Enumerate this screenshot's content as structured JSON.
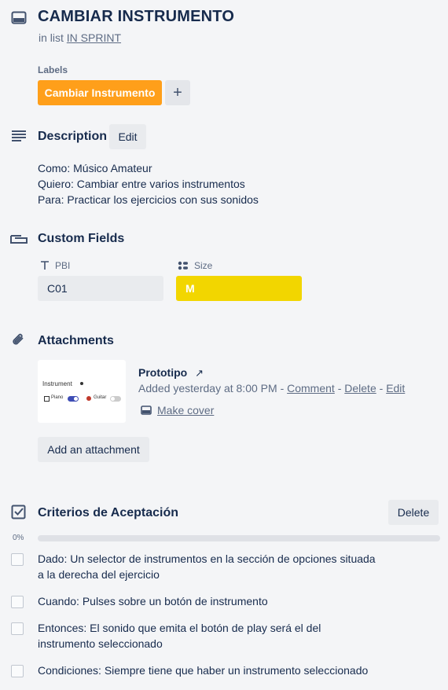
{
  "card": {
    "title": "CAMBIAR INSTRUMENTO",
    "in_list_prefix": "in list",
    "list_name": "IN SPRINT"
  },
  "labels": {
    "heading": "Labels",
    "items": [
      {
        "text": "Cambiar Instrumento",
        "color": "#ff9f1a"
      }
    ],
    "add_glyph": "+"
  },
  "description": {
    "title": "Description",
    "edit_label": "Edit",
    "lines": [
      "Como: Músico Amateur",
      "Quiero: Cambiar entre varios instrumentos",
      "Para: Practicar los ejercicios con sus sonidos"
    ]
  },
  "custom_fields": {
    "title": "Custom Fields",
    "pbi": {
      "label": "PBI",
      "value": "C01"
    },
    "size": {
      "label": "Size",
      "value": "M",
      "color": "#f2d600"
    }
  },
  "attachments": {
    "title": "Attachments",
    "item": {
      "name": "Prototipo",
      "open_glyph": "↗",
      "added": "Added yesterday at 8:00 PM",
      "sep": "-",
      "comment": "Comment",
      "delete": "Delete",
      "edit": "Edit",
      "make_cover": "Make cover",
      "thumb": {
        "heading": "Instrument",
        "opt1": "Piano",
        "opt2": "Guitar"
      }
    },
    "add_label": "Add an attachment"
  },
  "checklist": {
    "title": "Criterios de Aceptación",
    "delete_label": "Delete",
    "progress_text": "0%",
    "progress": 0,
    "items": [
      {
        "text": "Dado: Un selector de instrumentos en la sección de opciones situada a la derecha del ejercicio",
        "checked": false
      },
      {
        "text": "Cuando: Pulses sobre un botón de instrumento",
        "checked": false
      },
      {
        "text": "Entonces: El sonido que emita el botón de play será el del instrumento seleccionado",
        "checked": false
      },
      {
        "text": "Condiciones: Siempre tiene que haber un instrumento seleccionado",
        "checked": false
      }
    ]
  }
}
